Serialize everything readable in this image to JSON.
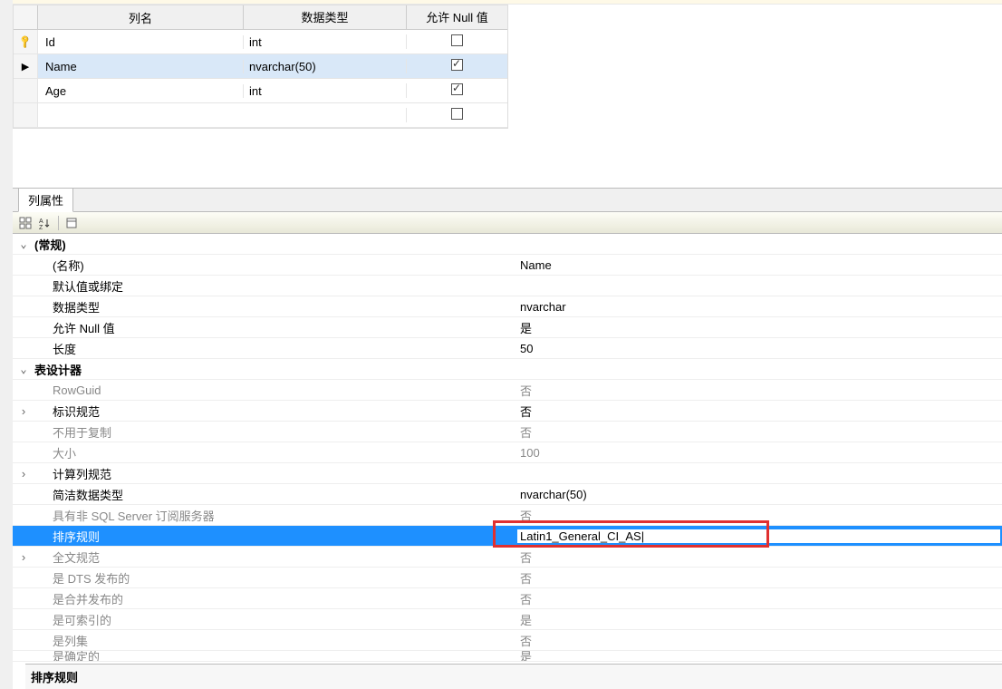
{
  "grid": {
    "headers": {
      "name": "列名",
      "type": "数据类型",
      "nulls": "允许 Null 值"
    },
    "rows": [
      {
        "key": true,
        "selected": false,
        "marker": "key",
        "name": "Id",
        "type": "int",
        "allow_null": false
      },
      {
        "key": false,
        "selected": true,
        "marker": "arrow",
        "name": "Name",
        "type": "nvarchar(50)",
        "allow_null": true
      },
      {
        "key": false,
        "selected": false,
        "marker": "",
        "name": "Age",
        "type": "int",
        "allow_null": true
      },
      {
        "key": false,
        "selected": false,
        "marker": "",
        "name": "",
        "type": "",
        "allow_null": false
      }
    ]
  },
  "properties_tab_label": "列属性",
  "property_groups": {
    "general": {
      "header": "(常规)",
      "rows": [
        {
          "label": "(名称)",
          "value": "Name",
          "expandable": false
        },
        {
          "label": "默认值或绑定",
          "value": "",
          "expandable": false
        },
        {
          "label": "数据类型",
          "value": "nvarchar",
          "expandable": false
        },
        {
          "label": "允许 Null 值",
          "value": "是",
          "expandable": false
        },
        {
          "label": "长度",
          "value": "50",
          "expandable": false
        }
      ]
    },
    "designer": {
      "header": "表设计器",
      "rows": [
        {
          "label": "RowGuid",
          "value": "否",
          "disabled": true,
          "expandable": false
        },
        {
          "label": "标识规范",
          "value": "否",
          "disabled": false,
          "expandable": true
        },
        {
          "label": "不用于复制",
          "value": "否",
          "disabled": true,
          "expandable": false
        },
        {
          "label": "大小",
          "value": "100",
          "disabled": true,
          "expandable": false
        },
        {
          "label": "计算列规范",
          "value": "",
          "disabled": false,
          "expandable": true
        },
        {
          "label": "简洁数据类型",
          "value": "nvarchar(50)",
          "disabled": false,
          "expandable": false
        },
        {
          "label": "具有非 SQL Server 订阅服务器",
          "value": "否",
          "disabled": true,
          "expandable": false
        },
        {
          "label": "排序规则",
          "value": "Latin1_General_CI_AS",
          "disabled": false,
          "expandable": false,
          "selected": true
        },
        {
          "label": "全文规范",
          "value": "否",
          "disabled": true,
          "expandable": true
        },
        {
          "label": "是 DTS 发布的",
          "value": "否",
          "disabled": true,
          "expandable": false
        },
        {
          "label": "是合并发布的",
          "value": "否",
          "disabled": true,
          "expandable": false
        },
        {
          "label": "是可索引的",
          "value": "是",
          "disabled": true,
          "expandable": false
        },
        {
          "label": "是列集",
          "value": "否",
          "disabled": true,
          "expandable": false
        },
        {
          "label": "是确定的",
          "value": "是",
          "disabled": true,
          "expandable": false,
          "cutoff": true
        }
      ]
    }
  },
  "footer_label": "排序规则"
}
